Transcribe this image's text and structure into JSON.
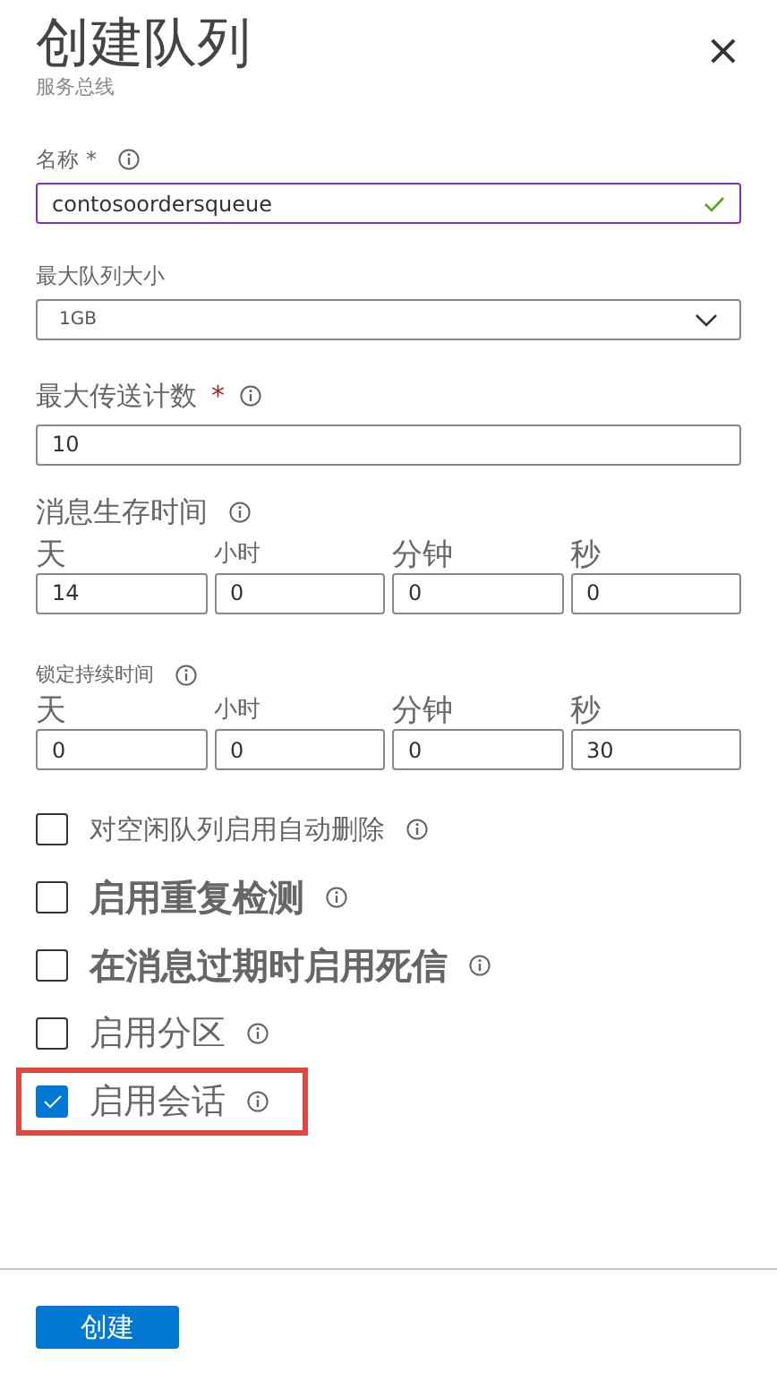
{
  "header": {
    "title": "创建队列",
    "subtitle": "服务总线",
    "close": "×"
  },
  "name_field": {
    "label": "名称",
    "required_mark": "*",
    "value": "contosoordersqueue",
    "valid": true
  },
  "size_field": {
    "label": "最大队列大小",
    "value": "1GB"
  },
  "delivery_field": {
    "label": "最大传送计数",
    "required_mark": "*",
    "value": "10"
  },
  "durations": [
    {
      "label": "消息生存时间",
      "parts": [
        {
          "unit": "天",
          "value": "14"
        },
        {
          "unit": "小时",
          "value": "0"
        },
        {
          "unit": "分钟",
          "value": "0"
        },
        {
          "unit": "秒",
          "value": "0"
        }
      ]
    },
    {
      "label": "锁定持续时间",
      "parts": [
        {
          "unit": "天",
          "value": "0"
        },
        {
          "unit": "小时",
          "value": "0"
        },
        {
          "unit": "分钟",
          "value": "0"
        },
        {
          "unit": "秒",
          "value": "30"
        }
      ]
    }
  ],
  "options": [
    {
      "label": "对空闲队列启用自动删除",
      "checked": false,
      "highlighted": false
    },
    {
      "label": "启用重复检测",
      "checked": false,
      "highlighted": false
    },
    {
      "label": "在消息过期时启用死信",
      "checked": false,
      "highlighted": false
    },
    {
      "label": "启用分区",
      "checked": false,
      "highlighted": false
    },
    {
      "label": "启用会话",
      "checked": true,
      "highlighted": true
    }
  ],
  "submit": {
    "label": "创建"
  }
}
